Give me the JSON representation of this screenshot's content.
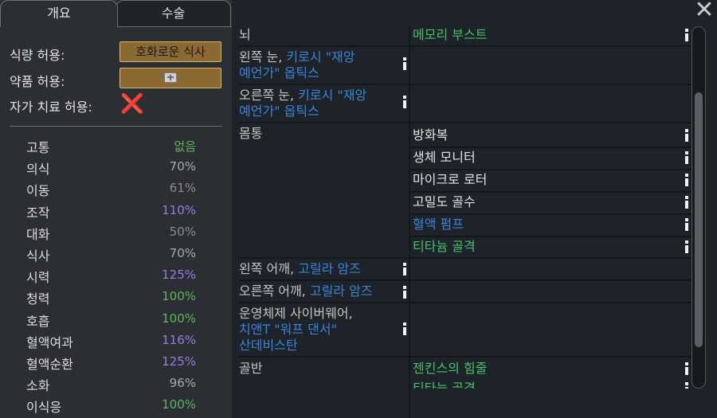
{
  "tabs": {
    "overview": "개요",
    "operations": "수술"
  },
  "options": {
    "food_label": "식량 허용:",
    "food_value": "호화로운 식사",
    "medicine_label": "약품 허용:",
    "selftend_label": "자가 치료 허용:",
    "selftend_mark": "❌"
  },
  "capacities": [
    {
      "name": "고통",
      "value": "없음",
      "color": "#5fb35f"
    },
    {
      "name": "의식",
      "value": "70%",
      "color": "#a9a9a9"
    },
    {
      "name": "이동",
      "value": "61%",
      "color": "#8c8c8c"
    },
    {
      "name": "조작",
      "value": "110%",
      "color": "#8f7fe0"
    },
    {
      "name": "대화",
      "value": "50%",
      "color": "#8c8c8c"
    },
    {
      "name": "식사",
      "value": "70%",
      "color": "#a9a9a9"
    },
    {
      "name": "시력",
      "value": "125%",
      "color": "#8f7fe0"
    },
    {
      "name": "청력",
      "value": "100%",
      "color": "#5fb35f"
    },
    {
      "name": "호흡",
      "value": "100%",
      "color": "#5fb35f"
    },
    {
      "name": "혈액여과",
      "value": "116%",
      "color": "#8f7fe0"
    },
    {
      "name": "혈액순환",
      "value": "125%",
      "color": "#8f7fe0"
    },
    {
      "name": "소화",
      "value": "96%",
      "color": "#a9a9a9"
    },
    {
      "name": "이식응",
      "value": "100%",
      "color": "#5fb35f"
    }
  ],
  "health": {
    "brain": {
      "part": "뇌",
      "hediff": "메모리 부스트",
      "hediff_color": "#47c06a"
    },
    "left_eye": {
      "prefix": "왼쪽 눈, ",
      "line1_hl": "키로시 \"재앙",
      "line2": "예언가\" 옵틱스"
    },
    "right_eye": {
      "prefix": "오른쪽 눈, ",
      "line1_hl": "키로시 \"재앙",
      "line2": "예언가\" 옵틱스"
    },
    "torso": {
      "part": "몸통",
      "hediffs": [
        {
          "text": "방화복",
          "color": "#e2e2e2"
        },
        {
          "text": "생체 모니터",
          "color": "#e2e2e2"
        },
        {
          "text": "마이크로 로터",
          "color": "#e2e2e2"
        },
        {
          "text": "고밀도 골수",
          "color": "#e2e2e2"
        },
        {
          "text": "혈액 펌프",
          "color": "#3a84d8"
        },
        {
          "text": "티타늄 골격",
          "color": "#47c06a"
        }
      ]
    },
    "left_shoulder": {
      "prefix": "왼쪽 어깨, ",
      "hl": "고릴라 암즈"
    },
    "right_shoulder": {
      "prefix": "오른쪽 어깨, ",
      "hl": "고릴라 암즈"
    },
    "nervous": {
      "line1": "운영체제 사이버웨어,",
      "line2": "치앤T \"워프 댄서\"",
      "line3": "산데비스탄"
    },
    "pelvis": {
      "part": "골반",
      "hediff": "젠킨스의 힘줄",
      "hediff_color": "#47c06a",
      "next_hediff": "티타늄 골격"
    }
  },
  "icons": {
    "close": "close-icon",
    "info": "info-icon",
    "medicine": "medicine-icon"
  }
}
